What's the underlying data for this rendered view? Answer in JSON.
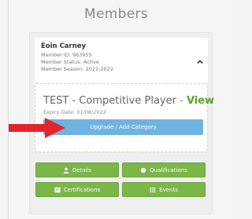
{
  "page": {
    "title": "Members"
  },
  "member": {
    "name": "Eoin Carney",
    "id_line": "Member ID: 963955",
    "status_line": "Member Status: Active",
    "season_line": "Member Season: 2021-2022"
  },
  "category": {
    "name": "TEST - Competitive Player",
    "separator": "-",
    "view_label": "View",
    "expiry": "Expiry Date: 31/08/2022",
    "upgrade_label": "Upgrade / Add Category"
  },
  "actions": {
    "details_label": "Details",
    "qualifications_label": "Qualifications",
    "certifications_label": "Certifications",
    "events_label": "Events"
  },
  "icons": {
    "collapse": "chevron-up-icon",
    "details": "person-icon",
    "qualifications": "circle-icon",
    "certifications": "certificate-icon",
    "events": "list-icon",
    "annotation": "red-arrow"
  },
  "colors": {
    "accent_green": "#7ab648",
    "view_green": "#5aa02c",
    "button_blue": "#6fb3e0",
    "arrow_red": "#e3242b"
  }
}
